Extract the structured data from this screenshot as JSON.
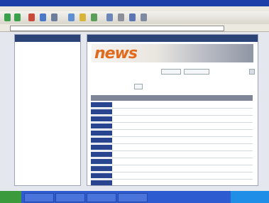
{
  "window": {
    "title": ""
  },
  "menu": {
    "items": [
      "",
      "",
      "",
      "",
      "",
      ""
    ]
  },
  "toolbar": {
    "buttons": [
      "back",
      "forward",
      "stop",
      "refresh",
      "home",
      "search",
      "favorites",
      "history",
      "mail",
      "print",
      "edit",
      "discuss"
    ]
  },
  "address": {
    "value": ""
  },
  "left_panel": {
    "title": "",
    "items": [
      "",
      "",
      "",
      "",
      "",
      "",
      "",
      ""
    ]
  },
  "main_panel": {
    "title": "",
    "logo_text_1": "news",
    "logo_text_2": "",
    "filter_1": "",
    "filter_2": "",
    "filter_label": "",
    "summary_left": "",
    "summary_right": ""
  },
  "table": {
    "headers": [
      "",
      "",
      "",
      "",
      "",
      "",
      "",
      ""
    ],
    "rows": 12
  },
  "taskbar": {
    "start_label": "",
    "tasks": [
      "",
      "",
      "",
      ""
    ],
    "clock": ""
  }
}
